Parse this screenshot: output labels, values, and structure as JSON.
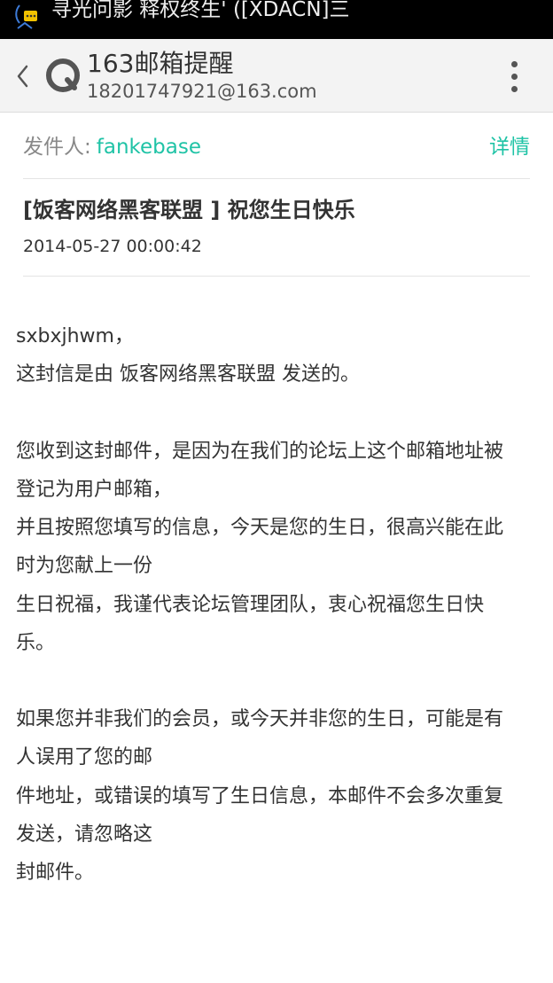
{
  "status_bar": {
    "notification_text": "寻光问影 释权终生' ([XDACN]三"
  },
  "header": {
    "title": "163邮箱提醒",
    "subtitle": "18201747921@163.com"
  },
  "email": {
    "sender_label": "发件人:",
    "sender_name": "fankebase",
    "details_label": "详情",
    "subject": "[饭客网络黑客联盟 ] 祝您生日快乐",
    "date": "2014-05-27 00:00:42",
    "body_lines": [
      "sxbxjhwm，",
      "这封信是由 饭客网络黑客联盟 发送的。",
      "您收到这封邮件，是因为在我们的论坛上这个邮箱地址被",
      "登记为用户邮箱，",
      "并且按照您填写的信息，今天是您的生日，很高兴能在此",
      "时为您献上一份",
      "生日祝福，我谨代表论坛管理团队，衷心祝福您生日快",
      "乐。",
      "如果您并非我们的会员，或今天并非您的生日，可能是有",
      "人误用了您的邮",
      "件地址，或错误的填写了生日信息，本邮件不会多次重复",
      "发送，请忽略这",
      "封邮件。"
    ]
  }
}
